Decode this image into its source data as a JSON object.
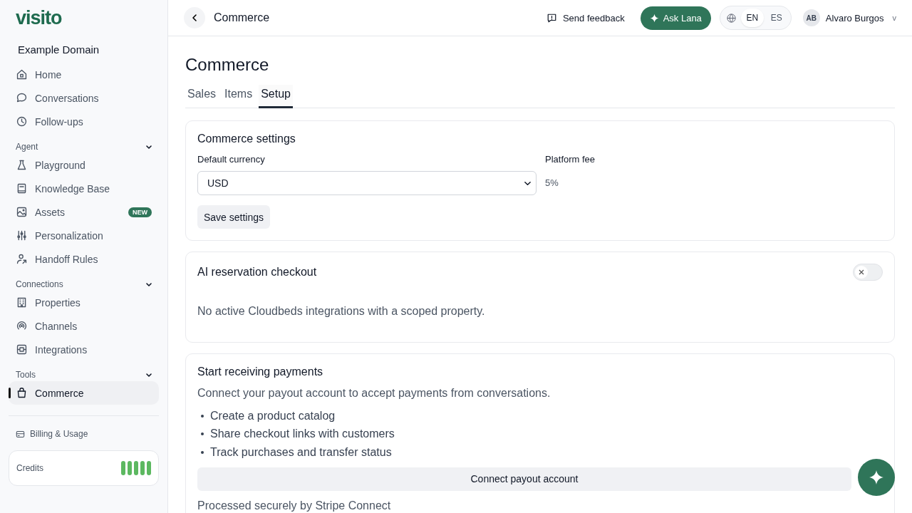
{
  "sidebar": {
    "logo": "visito",
    "workspace": "Example Domain",
    "sections": [
      {
        "items": [
          {
            "label": "Home",
            "selected": false
          },
          {
            "label": "Conversations",
            "selected": false
          },
          {
            "label": "Follow-ups",
            "selected": false
          }
        ]
      },
      {
        "title": "Agent",
        "expanded": true,
        "items": [
          {
            "label": "Playground",
            "selected": false
          },
          {
            "label": "Knowledge Base",
            "selected": false
          },
          {
            "label": "Assets",
            "selected": false,
            "badge": "NEW"
          },
          {
            "label": "Personalization",
            "selected": false
          },
          {
            "label": "Handoff Rules",
            "selected": false
          }
        ]
      },
      {
        "title": "Connections",
        "expanded": true,
        "items": [
          {
            "label": "Properties",
            "selected": false
          },
          {
            "label": "Channels",
            "selected": false
          },
          {
            "label": "Integrations",
            "selected": false
          }
        ]
      },
      {
        "title": "Tools",
        "expanded": true,
        "items": [
          {
            "label": "Commerce",
            "selected": true
          }
        ]
      }
    ],
    "billing": "Billing & Usage",
    "credits": {
      "label": "Credits",
      "level": 1
    }
  },
  "header": {
    "title": "Commerce",
    "feedback": "Send feedback",
    "assistant": "Ask Lana",
    "languages": [
      {
        "label": "EN",
        "selected": true
      },
      {
        "label": "ES",
        "selected": false
      }
    ],
    "user": {
      "initials": "AB",
      "name": "Alvaro Burgos",
      "caret": "v"
    }
  },
  "page": {
    "title": "Commerce",
    "tabs": [
      {
        "label": "Sales",
        "selected": false
      },
      {
        "label": "Items",
        "selected": false
      },
      {
        "label": "Setup",
        "selected": true
      }
    ],
    "settings": {
      "title": "Commerce settings",
      "currency_label": "Default currency",
      "currency": "USD",
      "fee_label": "Platform fee",
      "fee": "5%",
      "save": "Save settings"
    },
    "checkout": {
      "title": "AI reservation checkout",
      "on": false,
      "message": "No active Cloudbeds integrations with a scoped property."
    },
    "payments": {
      "title": "Start receiving payments",
      "intro": "Connect your payout account to accept payments from conversations.",
      "features": [
        "Create a product catalog",
        "Share checkout links with customers",
        "Track purchases and transfer status"
      ],
      "button": "Connect payout account",
      "note": "Processed securely by Stripe Connect"
    }
  }
}
